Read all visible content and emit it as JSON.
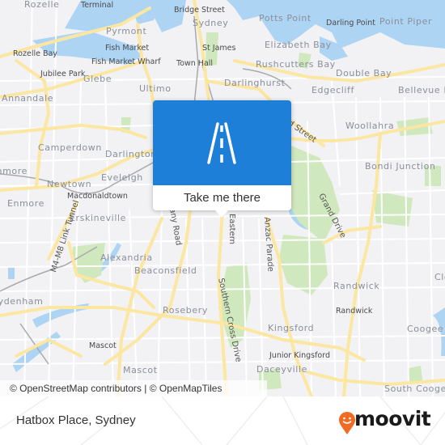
{
  "map": {
    "colors": {
      "land": "#f2f2f4",
      "water": "#aed4f4",
      "park": "#cfe8bd",
      "major_road": "#fbe6a2",
      "minor_road": "#ffffff",
      "rail": "#a9a9ad"
    },
    "suburb_labels": [
      "Rozelle",
      "Terminal",
      "Bridge Street",
      "Sydney",
      "Potts Point",
      "Darling Point",
      "Point Piper",
      "Pyrmont",
      "Fish Market",
      "Fish Market Wharf",
      "St James",
      "Elizabeth Bay",
      "Rozelle Bay",
      "Jubilee Park",
      "Glebe",
      "Town Hall",
      "Rushcutters Bay",
      "Double Bay",
      "Annandale",
      "Ultimo",
      "Darlinghurst",
      "Edgecliff",
      "Bellevue Hill",
      "Camperdown",
      "Darlington",
      "Woollahra",
      "Bondi Junction",
      "Enmore",
      "Eveleigh",
      "Newtown",
      "Macdonaldtown",
      "Enmore",
      "Erskineville",
      "Alexandria",
      "Beaconsfield",
      "Randwick",
      "Randwick",
      "Sydenham",
      "Rosebery",
      "Kingsford",
      "Coogee",
      "Clovelly",
      "Mascot",
      "Junior Kingsford",
      "Mascot",
      "Daceyville",
      "South Coogee"
    ],
    "road_labels": [
      "Grand Drive",
      "Anzac Parade",
      "Southern Cross Drive",
      "Eastern",
      "Botany Road",
      "M4-M8 Link Tunnel",
      "Oxford Street"
    ],
    "attribution": "© OpenStreetMap contributors | © OpenMapTiles"
  },
  "popup": {
    "icon": "road-icon",
    "label": "Take me there",
    "color": "#1e7fd9"
  },
  "footer": {
    "place_name": "Hatbox Place, Sydney",
    "logo_text": "moovit",
    "logo_icon": "moovit-pin-smile-icon",
    "logo_color": "#f26b22"
  }
}
